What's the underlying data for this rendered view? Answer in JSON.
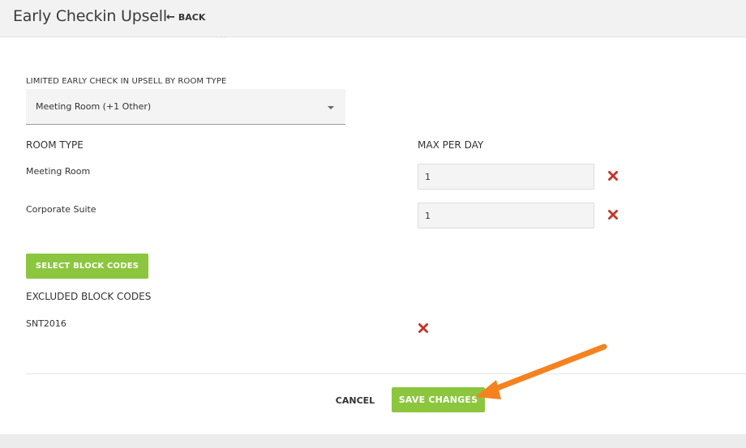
{
  "header": {
    "title": "Early Checkin Upsell",
    "back_label": "BACK"
  },
  "upsell": {
    "section_label": "LIMITED EARLY CHECK IN UPSELL BY ROOM TYPE",
    "selected_value": "Meeting Room (+1 Other)"
  },
  "room_table": {
    "headers": {
      "room_type": "ROOM TYPE",
      "max_per_day": "MAX PER DAY"
    },
    "rows": [
      {
        "room_type": "Meeting Room",
        "max_per_day": "1"
      },
      {
        "room_type": "Corporate Suite",
        "max_per_day": "1"
      }
    ]
  },
  "block_codes": {
    "select_button_label": "SELECT BLOCK CODES",
    "excluded_header": "EXCLUDED BLOCK CODES",
    "items": [
      {
        "code": "SNT2016"
      }
    ]
  },
  "footer": {
    "cancel_label": "CANCEL",
    "save_label": "SAVE CHANGES"
  },
  "colors": {
    "accent_green": "#8cc63f",
    "delete_red": "#c0392b",
    "annotation_orange": "#f5821f"
  },
  "icons": {
    "back": "left-arrow-icon",
    "delete": "close-x-icon",
    "dropdown": "caret-down-icon"
  }
}
